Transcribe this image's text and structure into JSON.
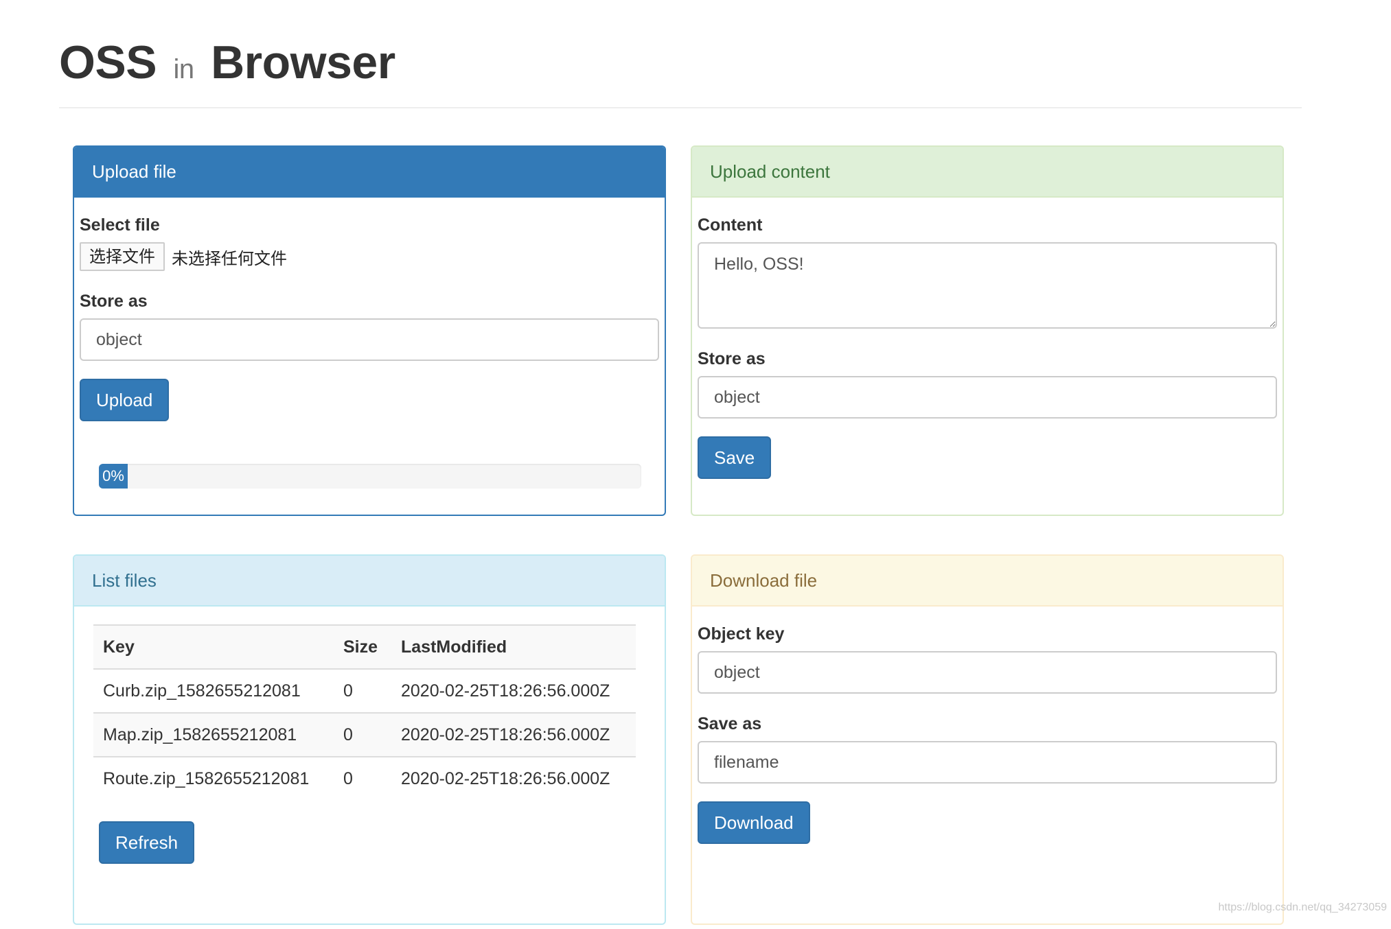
{
  "header": {
    "title_main": "OSS",
    "title_small": "in",
    "title_end": "Browser"
  },
  "upload_file": {
    "heading": "Upload file",
    "select_label": "Select file",
    "choose_button": "选择文件",
    "no_file_text": "未选择任何文件",
    "store_label": "Store as",
    "store_value": "object",
    "upload_button": "Upload",
    "progress_text": "0%",
    "progress_percent": 0
  },
  "upload_content": {
    "heading": "Upload content",
    "content_label": "Content",
    "content_value": "Hello, OSS!",
    "store_label": "Store as",
    "store_value": "object",
    "save_button": "Save"
  },
  "list_files": {
    "heading": "List files",
    "columns": [
      "Key",
      "Size",
      "LastModified"
    ],
    "rows": [
      [
        "Curb.zip_1582655212081",
        "0",
        "2020-02-25T18:26:56.000Z"
      ],
      [
        "Map.zip_1582655212081",
        "0",
        "2020-02-25T18:26:56.000Z"
      ],
      [
        "Route.zip_1582655212081",
        "0",
        "2020-02-25T18:26:56.000Z"
      ]
    ],
    "refresh_button": "Refresh"
  },
  "download_file": {
    "heading": "Download file",
    "key_label": "Object key",
    "key_value": "object",
    "saveas_label": "Save as",
    "saveas_value": "filename",
    "download_button": "Download"
  },
  "watermark": "https://blog.csdn.net/qq_34273059",
  "colors": {
    "primary": "#337ab7",
    "success_bg": "#dff0d8",
    "info_bg": "#d9edf7",
    "warning_bg": "#fcf8e3"
  }
}
